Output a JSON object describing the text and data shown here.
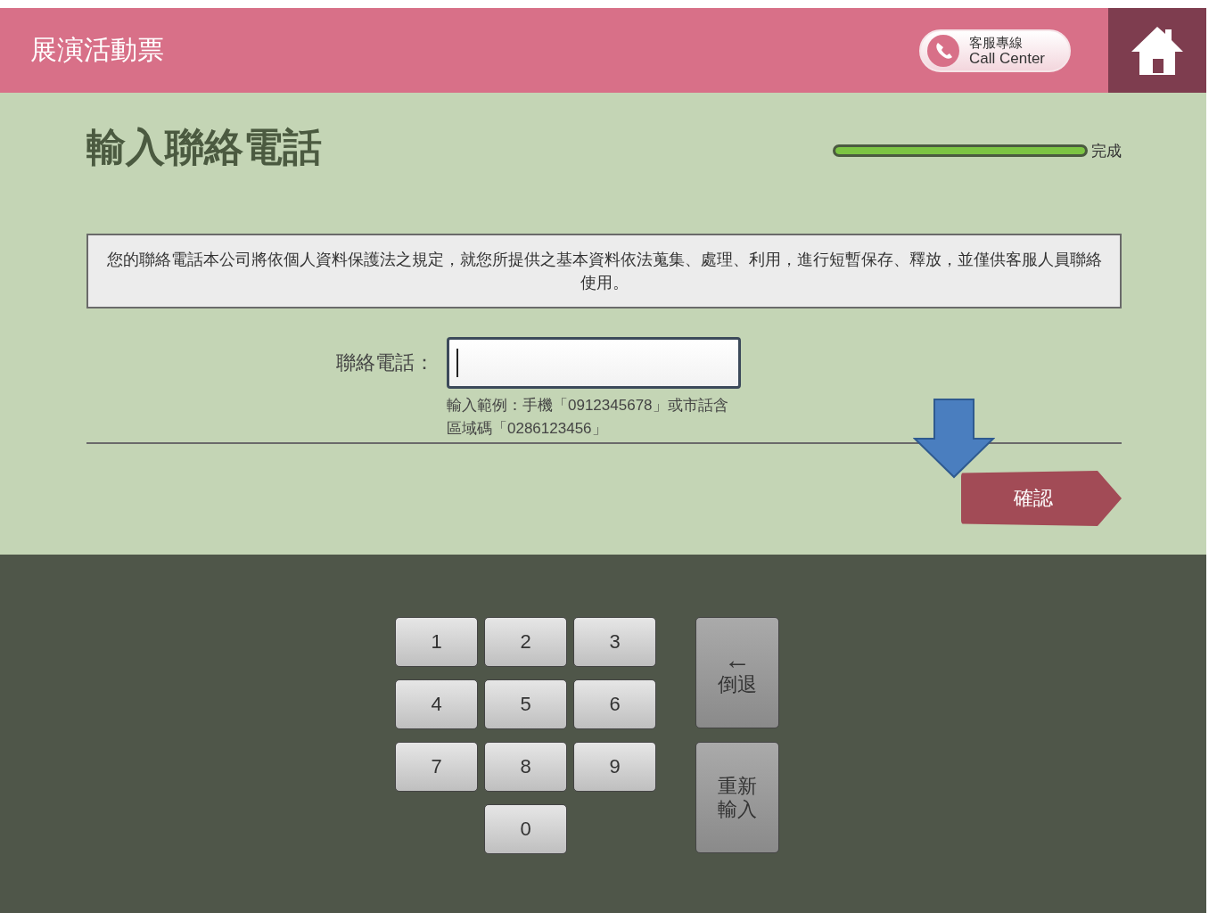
{
  "header": {
    "title": "展演活動票",
    "call_center": {
      "label_zh": "客服專線",
      "label_en": "Call Center"
    }
  },
  "page_title": "輸入聯絡電話",
  "progress": {
    "level": 1,
    "label": "完成"
  },
  "notice": "您的聯絡電話本公司將依個人資料保護法之規定，就您所提供之基本資料依法蒐集、處理、利用，進行短暫保存、釋放，並僅供客服人員聯絡使用。",
  "phone_field": {
    "label": "聯絡電話：",
    "hint": "輸入範例：手機「0912345678」或市話含區域碼「0286123456」"
  },
  "confirm_button": "確認",
  "keypad": {
    "keys": [
      "1",
      "2",
      "3",
      "4",
      "5",
      "6",
      "7",
      "8",
      "9",
      "0"
    ],
    "backspace": {
      "symbol": "←",
      "label": "倒退"
    },
    "clear": "重新輸入"
  }
}
